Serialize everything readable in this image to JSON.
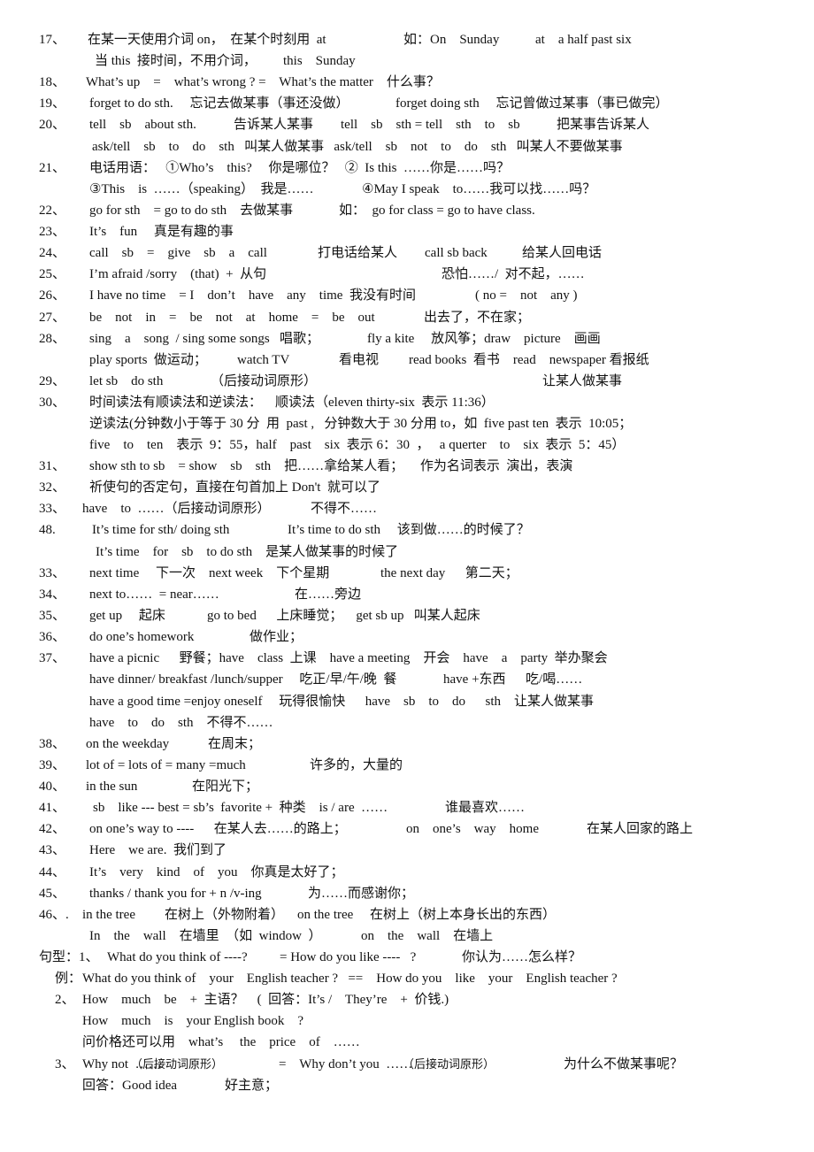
{
  "document": {
    "lines": [
      {
        "num": "17、",
        "segs": [
          "在某一天使用介词 on，  在某个时刻用  at",
          "如：On    Sunday",
          "at    a half past six"
        ]
      },
      {
        "num": "",
        "segs": [
          "当 this  接时间，不用介词，",
          "this    Sunday"
        ]
      },
      {
        "num": "18、",
        "segs": [
          "What’s up    =    what’s wrong ? =    What’s the matter    什么事？"
        ]
      },
      {
        "num": "19、",
        "segs": [
          "forget to do sth.     忘记去做某事（事还没做）",
          "forget doing sth     忘记曾做过某事（事已做完）"
        ]
      },
      {
        "num": "20、",
        "segs": [
          "tell    sb    about sth.",
          "告诉某人某事",
          "tell    sb    sth = tell    sth    to    sb",
          "把某事告诉某人"
        ]
      },
      {
        "num": "",
        "segs": [
          "ask/tell    sb    to    do    sth   叫某人做某事   ask/tell    sb    not    to    do    sth   叫某人不要做某事"
        ]
      },
      {
        "num": "21、",
        "segs": [
          "电话用语：   ①Who’s    this?     你是哪位？   ②  Is this  ……你是……吗？"
        ]
      },
      {
        "num": "",
        "segs": [
          "③This    is  ……（speaking）  我是……",
          "④May I speak    to……我可以找……吗？"
        ]
      },
      {
        "num": "22、",
        "segs": [
          "go for sth    = go to do sth    去做某事",
          "如：  go for class = go to have class."
        ]
      },
      {
        "num": "23、",
        "segs": [
          "It’s    fun     真是有趣的事"
        ]
      },
      {
        "num": "24、",
        "segs": [
          "call    sb    =    give    sb    a    call",
          "打电话给某人",
          "call sb back",
          "给某人回电话"
        ]
      },
      {
        "num": "25、",
        "segs": [
          "I’m afraid /sorry    (that)  +  从句",
          "恐怕……/  对不起，……"
        ]
      },
      {
        "num": "26、",
        "segs": [
          "I have no time    = I    don’t    have    any    time  我没有时间",
          "( no =    not    any )"
        ]
      },
      {
        "num": "27、",
        "segs": [
          "be    not    in    =    be    not    at    home    =    be    out",
          "出去了，不在家；"
        ]
      },
      {
        "num": "28、",
        "segs": [
          "sing    a    song  / sing some songs   唱歌；",
          "fly a kite     放风筝；draw    picture    画画"
        ]
      },
      {
        "num": "",
        "segs": [
          "play sports  做运动；",
          "watch TV",
          "看电视",
          "read books  看书    read    newspaper 看报纸"
        ]
      },
      {
        "num": "29、",
        "segs": [
          "let sb    do sth",
          "（后接动词原形）",
          "让某人做某事"
        ]
      },
      {
        "num": "30、",
        "segs": [
          "时间读法有顺读法和逆读法：    顺读法（eleven thirty-six  表示 11:36）"
        ]
      },
      {
        "num": "",
        "segs": [
          "逆读法(分钟数小于等于 30 分  用  past ,   分钟数大于 30 分用 to，如  five past ten  表示  10:05；"
        ]
      },
      {
        "num": "",
        "segs": [
          "five    to    ten    表示  9：55，half    past    six  表示 6：30  ，   a querter    to    six  表示  5：45）"
        ]
      },
      {
        "num": "31、",
        "segs": [
          "show sth to sb    = show    sb    sth    把……拿给某人看；     作为名词表示  演出，表演"
        ]
      },
      {
        "num": "32、",
        "segs": [
          "祈使句的否定句，直接在句首加上 Don't  就可以了"
        ]
      },
      {
        "num": "33、",
        "segs": [
          "have    to  ……（后接动词原形）",
          "不得不……"
        ]
      },
      {
        "num": "48.",
        "segs": [
          "It’s time for sth/ doing sth",
          "It’s time to do sth     该到做……的时候了？"
        ]
      },
      {
        "num": "",
        "segs": [
          "It’s time    for    sb    to do sth    是某人做某事的时候了"
        ]
      },
      {
        "num": "33、",
        "segs": [
          "next time     下一次    next week    下个星期",
          "the next day      第二天；"
        ]
      },
      {
        "num": "34、",
        "segs": [
          "next to……  = near……",
          "在……旁边"
        ]
      },
      {
        "num": "35、",
        "segs": [
          "get up     起床",
          "go to bed      上床睡觉；    get sb up   叫某人起床"
        ]
      },
      {
        "num": "36、",
        "segs": [
          "do one’s homework",
          "做作业；"
        ]
      },
      {
        "num": "37、",
        "segs": [
          "have a picnic      野餐；have    class  上课    have a meeting    开会    have    a    party  举办聚会"
        ]
      },
      {
        "num": "",
        "segs": [
          "have dinner/ breakfast /lunch/supper     吃正/早/午/晚  餐",
          "have +东西      吃/喝……"
        ]
      },
      {
        "num": "",
        "segs": [
          "have a good time =enjoy oneself     玩得很愉快      have    sb    to    do      sth    让某人做某事"
        ]
      },
      {
        "num": "",
        "segs": [
          "have    to    do    sth    不得不……"
        ]
      },
      {
        "num": "38、",
        "segs": [
          "on the weekday",
          "在周末；"
        ]
      },
      {
        "num": "39、",
        "segs": [
          "lot of = lots of = many =much",
          "许多的，大量的"
        ]
      },
      {
        "num": "40、",
        "segs": [
          "in the sun",
          "在阳光下；"
        ]
      },
      {
        "num": "41、",
        "segs": [
          "sb    like --- best = sb’s  favorite +  种类    is / are  ……",
          "谁最喜欢……"
        ]
      },
      {
        "num": "42、",
        "segs": [
          "on one’s way to ----      在某人去……的路上；",
          "on    one’s    way    home",
          "在某人回家的路上"
        ]
      },
      {
        "num": "43、",
        "segs": [
          "Here    we are.  我们到了"
        ]
      },
      {
        "num": "44、",
        "segs": [
          "It’s    very    kind    of    you    你真是太好了；"
        ]
      },
      {
        "num": "45、",
        "segs": [
          "thanks / thank you for + n /v-ing",
          "为……而感谢你；"
        ]
      },
      {
        "num": "46、.",
        "segs": [
          "in the tree",
          "在树上（外物附着）    on the tree     在树上（树上本身长出的东西）"
        ]
      },
      {
        "num": "",
        "segs": [
          "In    the    wall    在墙里  （如  window  ）",
          "on    the    wall    在墙上"
        ]
      },
      {
        "num": "句型：1、",
        "segs": [
          "What do you think of ----?",
          "= How do you like ----   ?",
          "你认为……怎么样？"
        ]
      },
      {
        "num": "例：",
        "segs": [
          "What do you think of    your    English teacher ?   ==    How do you    like    your    English teacher ?"
        ]
      },
      {
        "num": "2、",
        "segs": [
          "How    much    be    +  主语？    (  回答：It’s /    They’re    +  价钱.)"
        ]
      },
      {
        "num": "",
        "segs": [
          "How    much    is    your English book    ?"
        ]
      },
      {
        "num": "",
        "segs": [
          "问价格还可以用    what’s     the    price    of    ……"
        ]
      },
      {
        "num": "3、",
        "segs": [
          "Why not  ……",
          "（后接动词原形）",
          "=    Why don’t you  ……",
          "（后接动词原形）",
          "为什么不做某事呢？"
        ]
      },
      {
        "num": "",
        "segs": [
          "回答：Good idea",
          "好主意；"
        ]
      }
    ]
  }
}
